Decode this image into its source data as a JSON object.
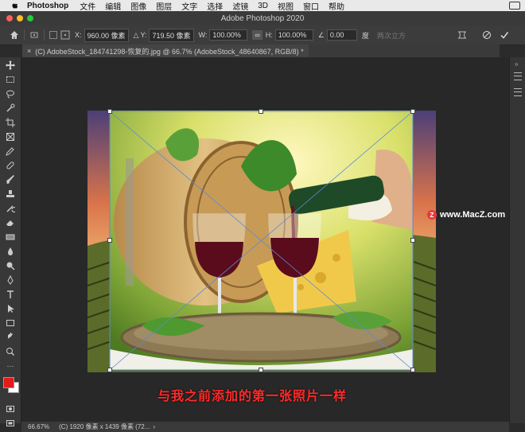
{
  "menubar": {
    "app_name": "Photoshop",
    "items": [
      "文件",
      "编辑",
      "图像",
      "图层",
      "文字",
      "选择",
      "滤镜",
      "3D",
      "视图",
      "窗口",
      "帮助"
    ]
  },
  "titlebar": {
    "title": "Adobe Photoshop 2020"
  },
  "options": {
    "x_label": "X:",
    "x_value": "960.00 像素",
    "y_label": "Y:",
    "y_value": "719.50 像素",
    "w_label": "W:",
    "w_value": "100.00%",
    "h_label": "H:",
    "h_value": "100.00%",
    "angle_value": "0.00",
    "angle_unit": "度",
    "interp_label": "两次立方"
  },
  "tab": {
    "title": "(C) AdobeStock_184741298-恢复的.jpg @ 66.7% (AdobeStock_48640867, RGB/8) *"
  },
  "status": {
    "zoom": "66.67%",
    "doc_info": "(C) 1920 像素 x 1439 像素 (72..."
  },
  "watermark": {
    "text": "www.MacZ.com",
    "logo": "Z"
  },
  "caption": {
    "text": "与我之前添加的第一张照片一样"
  },
  "colors": {
    "foreground": "#e21b1b",
    "background": "#ffffff",
    "caption": "#ff2b2b"
  }
}
